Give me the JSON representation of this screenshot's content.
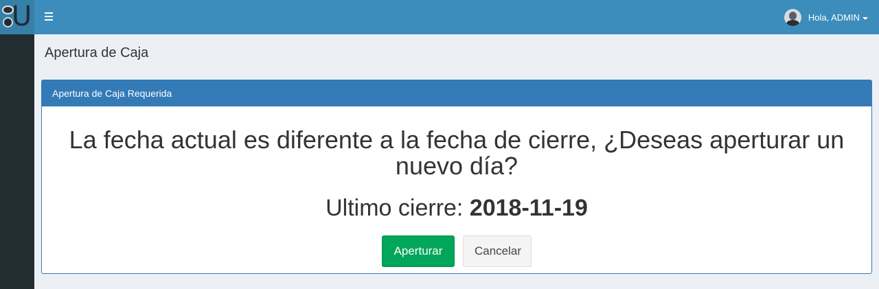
{
  "header": {
    "user_label": "Hola, ADMIN"
  },
  "page": {
    "title": "Apertura de Caja"
  },
  "panel": {
    "heading": "Apertura de Caja Requerida",
    "message": "La fecha actual es diferente a la fecha de cierre, ¿Deseas aperturar un nuevo día?",
    "last_close_label": "Ultimo cierre:",
    "last_close_date": "2018-11-19",
    "confirm_label": "Aperturar",
    "cancel_label": "Cancelar"
  },
  "colors": {
    "header": "#3c8dbc",
    "sidebar": "#222d32",
    "panel_primary": "#337ab7",
    "success": "#00a65a"
  },
  "icons": {
    "menu": "hamburger-icon",
    "user": "avatar",
    "dropdown": "caret-down-icon"
  }
}
